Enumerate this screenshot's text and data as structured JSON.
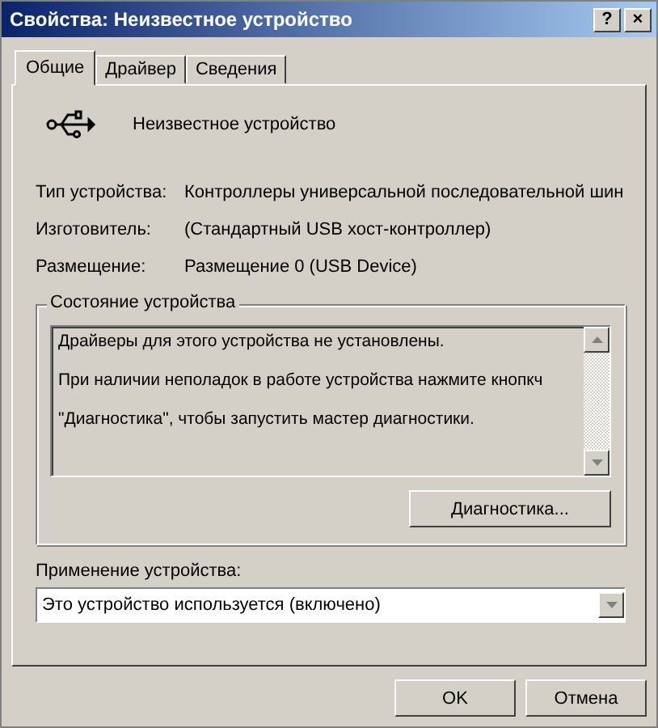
{
  "window": {
    "title": "Свойства: Неизвестное устройство",
    "title_buttons": [
      "?",
      "×"
    ]
  },
  "tabs": [
    {
      "label": "Общие",
      "selected": true
    },
    {
      "label": "Драйвер",
      "selected": false
    },
    {
      "label": "Сведения",
      "selected": false
    }
  ],
  "device_name": "Неизвестное устройство",
  "properties": [
    {
      "label": "Тип устройства:",
      "value": "Контроллеры универсальной последовательной шин"
    },
    {
      "label": "Изготовитель:",
      "value": "(Стандартный USB хост-контроллер)"
    },
    {
      "label": "Размещение:",
      "value": "Размещение 0 (USB Device)"
    }
  ],
  "status_group": {
    "title": "Состояние устройства",
    "lines": [
      "Драйверы для этого устройства не установлены.",
      "При наличии неполадок в работе устройства нажмите кнопкч",
      "\"Диагностика\", чтобы запустить мастер диагностики."
    ],
    "button": "Диагностика..."
  },
  "usage": {
    "label": "Применение устройства:",
    "value": "Это устройство используется (включено)"
  },
  "buttons": [
    "OK",
    "Отмена"
  ]
}
